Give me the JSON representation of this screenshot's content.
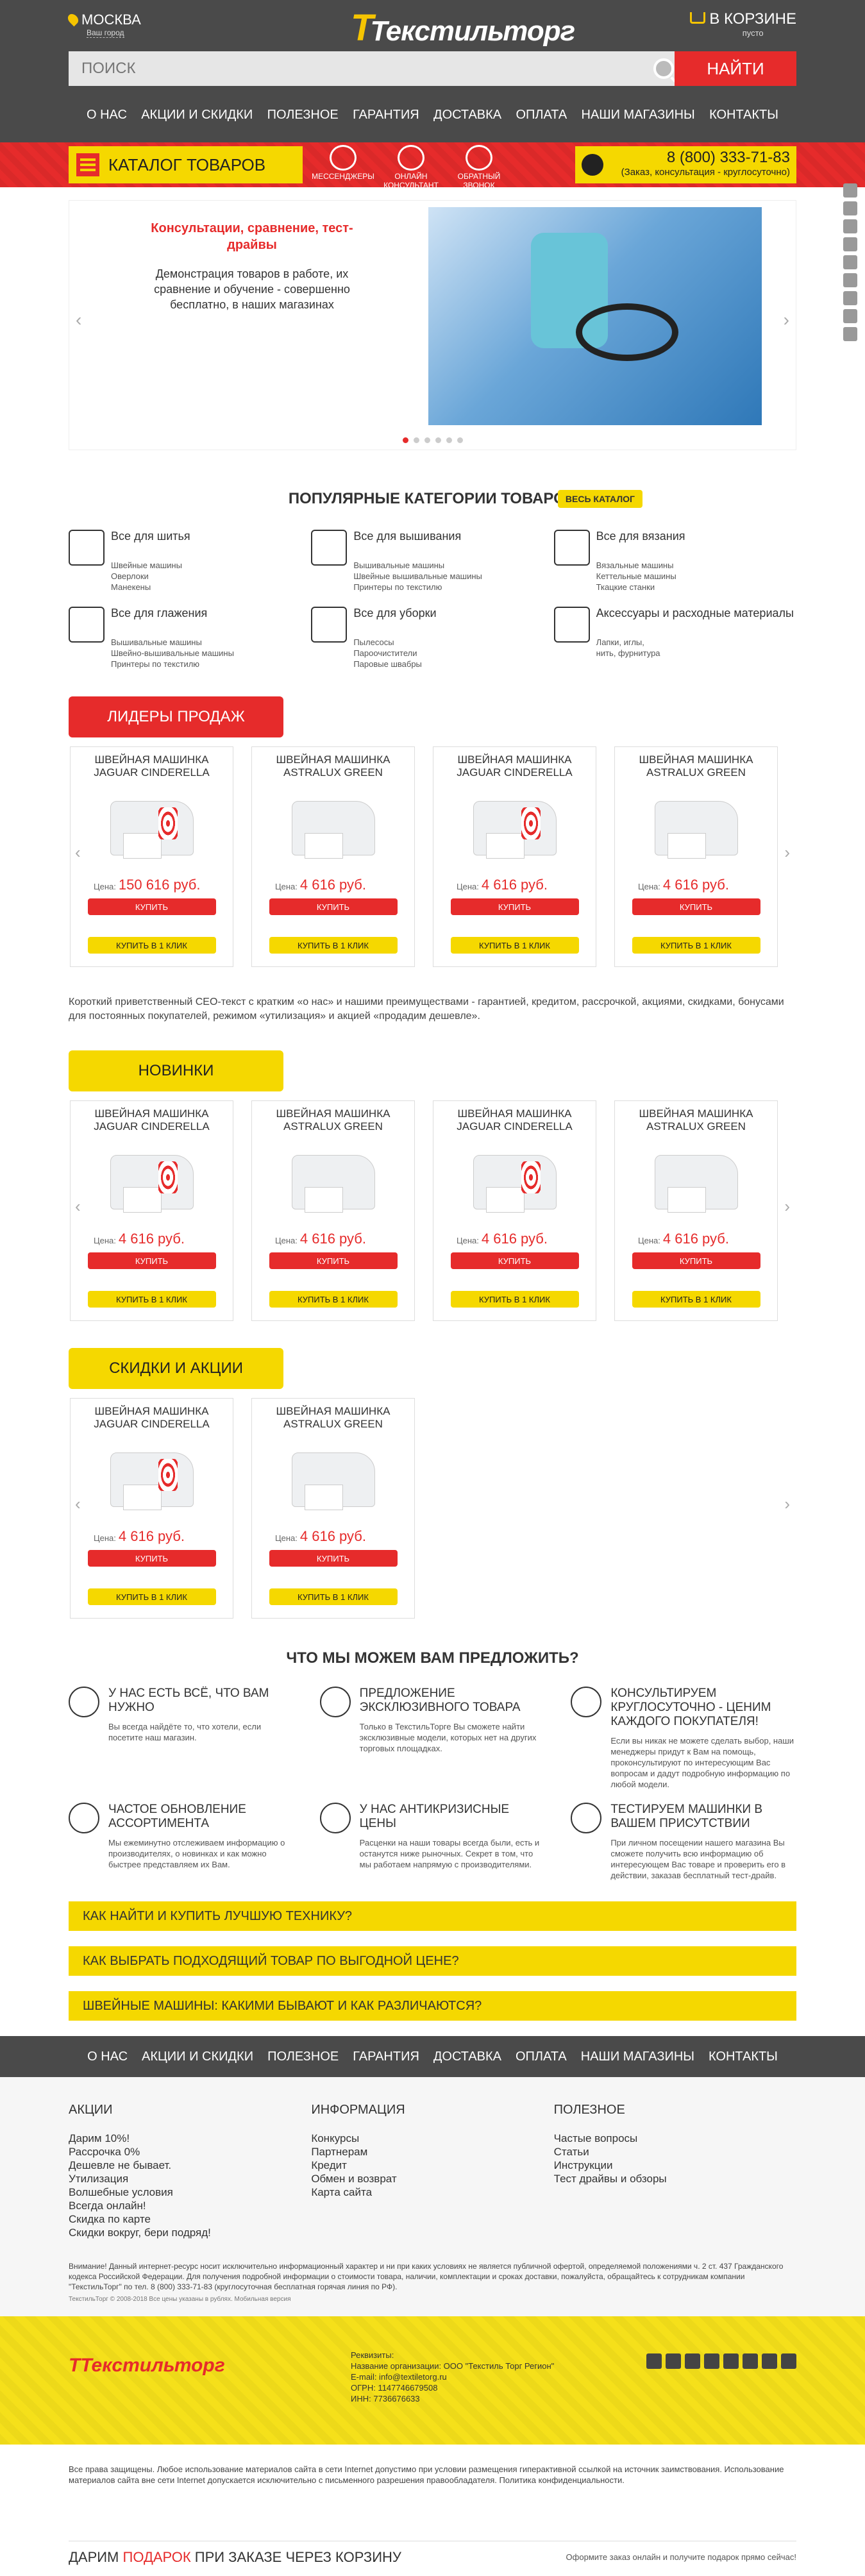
{
  "header": {
    "city": "МОСКВА",
    "city_sub": "Ваш город",
    "logo": "Текстильторг",
    "logo_letter": "Т",
    "cart": "В КОРЗИНЕ",
    "cart_sub": "пусто"
  },
  "search": {
    "placeholder": "ПОИСК",
    "button": "НАЙТИ"
  },
  "nav": [
    "О НАС",
    "АКЦИИ И СКИДКИ",
    "ПОЛЕЗНОЕ",
    "ГАРАНТИЯ",
    "ДОСТАВКА",
    "ОПЛАТА",
    "НАШИ МАГАЗИНЫ",
    "КОНТАКТЫ"
  ],
  "band": {
    "catalog": "КАТАЛОГ ТОВАРОВ",
    "links": [
      "МЕССЕНДЖЕРЫ",
      "ОНЛАЙН КОНСУЛЬТАНТ",
      "ОБРАТНЫЙ ЗВОНОК"
    ],
    "phone": "8 (800) 333-71-83",
    "phone_sub": "(Заказ, консультация - круглосуточно)"
  },
  "slider": {
    "title": "Консультации, сравнение, тест-драйвы",
    "text": "Демонстрация товаров в работе, их сравнение и обучение - совершенно бесплатно, в наших магазинах",
    "prev": "‹",
    "next": "›"
  },
  "categories": {
    "heading": "ПОПУЛЯРНЫЕ КАТЕГОРИИ ТОВАРОВ",
    "all": "ВЕСЬ КАТАЛОГ",
    "items": [
      {
        "title": "Все для шитья",
        "sub": [
          "Швейные машины",
          "Оверлоки",
          "Манекены"
        ]
      },
      {
        "title": "Все для вышивания",
        "sub": [
          "Вышивальные машины",
          "Швейные вышивальные машины",
          "Принтеры по текстилю"
        ]
      },
      {
        "title": "Все для вязания",
        "sub": [
          "Вязальные машины",
          "Кеттельные машины",
          "Ткацкие станки"
        ]
      },
      {
        "title": "Все для глажения",
        "sub": [
          "Вышивальные машины",
          "Швейно-вышивальные машины",
          "Принтеры по текстилю"
        ]
      },
      {
        "title": "Все для уборки",
        "sub": [
          "Пылесосы",
          "Пароочистители",
          "Паровые швабры"
        ]
      },
      {
        "title": "Аксессуары и расходные материалы",
        "sub": [
          "Лапки, иглы,",
          "нить, фурнитура"
        ]
      }
    ]
  },
  "leaders": {
    "label": "ЛИДЕРЫ ПРОДАЖ",
    "products": [
      {
        "name": "ШВЕЙНАЯ МАШИНКА JAGUAR CINDERELLA",
        "price_label": "Цена:",
        "price": "150 616 руб."
      },
      {
        "name": "ШВЕЙНАЯ МАШИНКА ASTRALUX GREEN",
        "price_label": "Цена:",
        "price": "4 616 руб."
      },
      {
        "name": "ШВЕЙНАЯ МАШИНКА JAGUAR CINDERELLA",
        "price_label": "Цена:",
        "price": "4 616 руб."
      },
      {
        "name": "ШВЕЙНАЯ МАШИНКА ASTRALUX GREEN",
        "price_label": "Цена:",
        "price": "4 616 руб."
      }
    ]
  },
  "buttons": {
    "buy": "КУПИТЬ",
    "one_click": "КУПИТЬ В 1 КЛИК"
  },
  "seo": "Короткий приветственный СЕО-текст с кратким «о нас» и нашими преимуществами - гарантией, кредитом, рассрочкой, акциями, скидками, бонусами для постоянных покупателей, режимом «утилизация» и акцией «продадим дешевле».",
  "novelties": {
    "label": "НОВИНКИ",
    "products": [
      {
        "name": "ШВЕЙНАЯ МАШИНКА JAGUAR CINDERELLA",
        "price_label": "Цена:",
        "price": "4 616 руб."
      },
      {
        "name": "ШВЕЙНАЯ МАШИНКА ASTRALUX GREEN",
        "price_label": "Цена:",
        "price": "4 616 руб."
      },
      {
        "name": "ШВЕЙНАЯ МАШИНКА JAGUAR CINDERELLA",
        "price_label": "Цена:",
        "price": "4 616 руб."
      },
      {
        "name": "ШВЕЙНАЯ МАШИНКА ASTRALUX GREEN",
        "price_label": "Цена:",
        "price": "4 616 руб."
      }
    ]
  },
  "sales": {
    "label": "СКИДКИ И АКЦИИ",
    "products": [
      {
        "name": "ШВЕЙНАЯ МАШИНКА JAGUAR CINDERELLA",
        "price_label": "Цена:",
        "price": "4 616 руб."
      },
      {
        "name": "ШВЕЙНАЯ МАШИНКА ASTRALUX GREEN",
        "price_label": "Цена:",
        "price": "4 616 руб."
      }
    ]
  },
  "offers": {
    "heading": "ЧТО МЫ МОЖЕМ ВАМ ПРЕДЛОЖИТЬ?",
    "items": [
      {
        "title": "У НАС ЕСТЬ ВСЁ, ЧТО ВАМ НУЖНО",
        "text": "Вы всегда найдёте то, что хотели, если посетите наш магазин."
      },
      {
        "title": "ПРЕДЛОЖЕНИЕ ЭКСКЛЮЗИВНОГО ТОВАРА",
        "text": "Только в ТекстильТорге Вы сможете найти эксклюзивные модели, которых нет на других торговых площадках."
      },
      {
        "title": "КОНСУЛЬТИРУЕМ КРУГЛОСУТОЧНО - ЦЕНИМ КАЖДОГО ПОКУПАТЕЛЯ!",
        "text": "Если вы никак не можете сделать выбор, наши менеджеры придут к Вам на помощь, проконсультируют по интересующим Вас вопросам и дадут подробную информацию по любой модели."
      },
      {
        "title": "ЧАСТОЕ ОБНОВЛЕНИЕ АССОРТИМЕНТА",
        "text": "Мы ежеминутно отслеживаем информацию о производителях, о новинках и как можно быстрее представляем их Вам."
      },
      {
        "title": "У НАС АНТИКРИЗИСНЫЕ ЦЕНЫ",
        "text": "Расценки на наши товары всегда были, есть и останутся ниже рыночных. Секрет в том, что мы работаем напрямую с производителями."
      },
      {
        "title": "ТЕСТИРУЕМ МАШИНКИ В ВАШЕМ ПРИСУТСТВИИ",
        "text": "При личном посещении нашего магазина Вы сможете получить всю информацию об интересующем Вас товаре и проверить его в действии, заказав бесплатный тест-драйв."
      }
    ]
  },
  "faq": [
    "КАК НАЙТИ И КУПИТЬ ЛУЧШУЮ ТЕХНИКУ?",
    "КАК ВЫБРАТЬ ПОДХОДЯЩИЙ ТОВАР ПО ВЫГОДНОЙ ЦЕНЕ?",
    "ШВЕЙНЫЕ МАШИНЫ: КАКИМИ БЫВАЮТ И КАК РАЗЛИЧАЮТСЯ?"
  ],
  "footer": {
    "cols": [
      {
        "title": "АКЦИИ",
        "items": [
          "Дарим 10%!",
          "Рассрочка 0%",
          "Дешевле не бывает.",
          "Утилизация",
          "Волшебные условия",
          "Всегда онлайн!",
          "Скидка по карте",
          "Скидки вокруг, бери подряд!"
        ]
      },
      {
        "title": "ИНФОРМАЦИЯ",
        "items": [
          "Конкурсы",
          "Партнерам",
          "Кредит",
          "Обмен и возврат",
          "Карта сайта"
        ]
      },
      {
        "title": "ПОЛЕЗНОЕ",
        "items": [
          "Частые вопросы",
          "Статьи",
          "Инструкции",
          "Тест драйвы и обзоры"
        ]
      }
    ],
    "warning": "Внимание! Данный интернет-ресурс носит исключительно информационный характер и ни при каких условиях не является публичной офертой, определяемой положениями ч. 2 ст. 437 Гражданского кодекса Российской Федерации. Для получения подробной информации о стоимости товара, наличии, комплектации и сроках доставки, пожалуйста, обращайтесь к сотрудникам компании \"ТекстильТорг\" по тел. 8 (800) 333-71-83 (круглосуточная бесплатная горячая линия по РФ).",
    "warning_small": "ТекстильТорг © 2008-2018 Все цены указаны в рублях. Мобильная версия",
    "requisites": [
      "Реквизиты:",
      "Название организации: ООО \"Текстиль Торг Регион\"",
      "E-mail: info@textiletorg.ru",
      "ОГРН: 1147746679508",
      "ИНН: 7736676633"
    ],
    "copyright": "Все права защищены. Любое использование материалов сайта в сети Internet допустимо при условии размещения гиперактивной ссылкой на источник заимствования. Использование материалов сайта вне сети Internet допускается исключительно с письменного разрешения правообладателя. Политика конфиденциальности.",
    "gift_a": "ДАРИМ ",
    "gift_b": "ПОДАРОК",
    "gift_c": " ПРИ ЗАКАЗЕ ЧЕРЕЗ КОРЗИНУ",
    "gift_r": "Оформите заказ онлайн и получите подарок прямо сейчас!"
  }
}
